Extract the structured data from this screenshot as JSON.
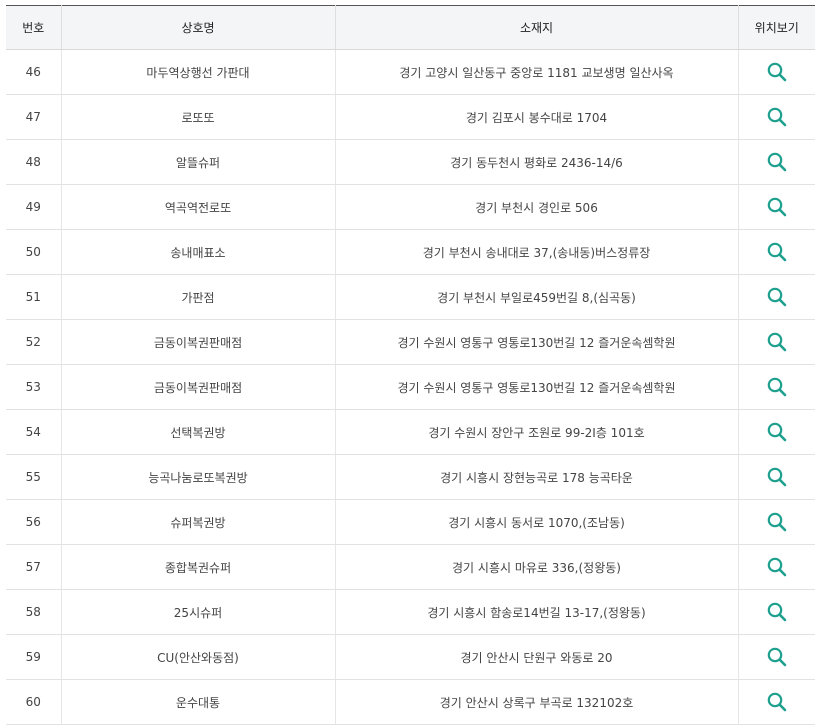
{
  "table": {
    "headers": {
      "no": "번호",
      "name": "상호명",
      "address": "소재지",
      "map": "위치보기"
    },
    "map_icon": "search-icon",
    "accent_color": "#1fa08f",
    "rows": [
      {
        "no": "46",
        "name": "마두역상행선 가판대",
        "address": "경기 고양시 일산동구 중앙로 1181 교보생명 일산사옥"
      },
      {
        "no": "47",
        "name": "로또또",
        "address": "경기 김포시 봉수대로 1704"
      },
      {
        "no": "48",
        "name": "알뜰슈퍼",
        "address": "경기 동두천시 평화로 2436-14/6"
      },
      {
        "no": "49",
        "name": "역곡역전로또",
        "address": "경기 부천시 경인로 506"
      },
      {
        "no": "50",
        "name": "송내매표소",
        "address": "경기 부천시 송내대로 37,(송내동)버스정류장"
      },
      {
        "no": "51",
        "name": "가판점",
        "address": "경기 부천시 부일로459번길 8,(심곡동)"
      },
      {
        "no": "52",
        "name": "금동이복권판매점",
        "address": "경기 수원시 영통구 영통로130번길 12 즐거운속셈학원"
      },
      {
        "no": "53",
        "name": "금동이복권판매점",
        "address": "경기 수원시 영통구 영통로130번길 12 즐거운속셈학원"
      },
      {
        "no": "54",
        "name": "선택복권방",
        "address": "경기 수원시 장안구 조원로 99-2I층 101호"
      },
      {
        "no": "55",
        "name": "능곡나눔로또복권방",
        "address": "경기 시흥시 장현능곡로 178 능곡타운"
      },
      {
        "no": "56",
        "name": "슈퍼복권방",
        "address": "경기 시흥시 동서로 1070,(조남동)"
      },
      {
        "no": "57",
        "name": "종합복권슈퍼",
        "address": "경기 시흥시 마유로 336,(정왕동)"
      },
      {
        "no": "58",
        "name": "25시슈퍼",
        "address": "경기 시흥시 함송로14번길 13-17,(정왕동)"
      },
      {
        "no": "59",
        "name": "CU(안산와동점)",
        "address": "경기 안산시 단원구 와동로 20"
      },
      {
        "no": "60",
        "name": "운수대통",
        "address": "경기 안산시 상록구 부곡로 132102호"
      }
    ]
  }
}
